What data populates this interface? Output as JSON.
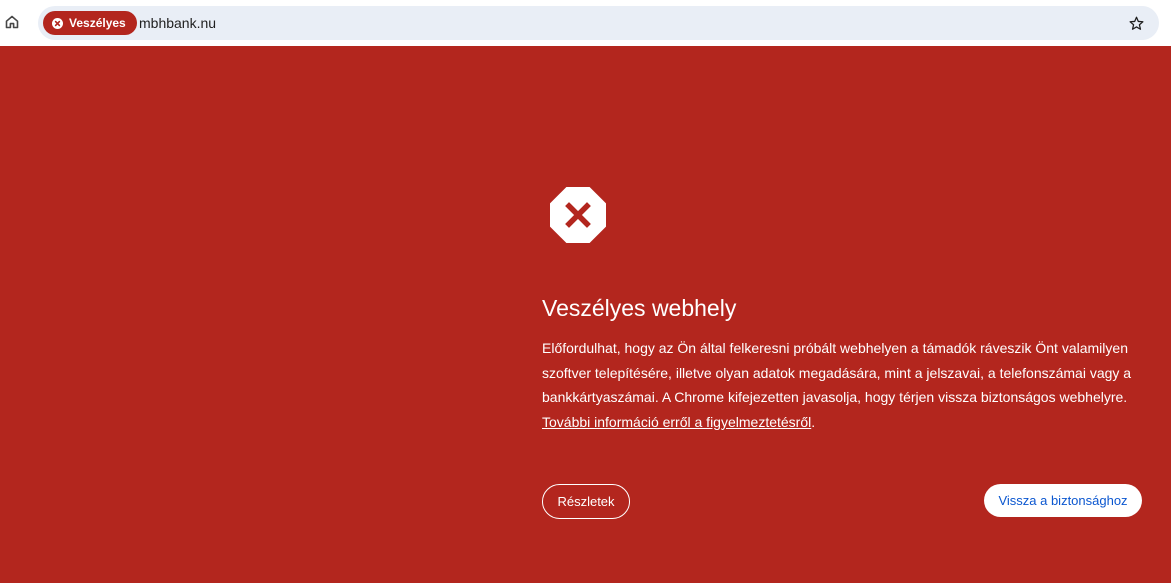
{
  "toolbar": {
    "home_icon": "home-icon",
    "bookmark_icon": "star-icon",
    "omnibox": {
      "security_chip_label": "Veszélyes",
      "security_chip_icon": "error-circle-icon",
      "url": "mbhbank.nu"
    }
  },
  "interstitial": {
    "icon": "danger-octagon-icon",
    "heading": "Veszélyes webhely",
    "body": "Előfordulhat, hogy az Ön által felkeresni próbált webhelyen a támadók ráveszik Önt valamilyen szoftver telepítésére, illetve olyan adatok megadására, mint a jelszavai, a telefonszámai vagy a bankkártyaszámai. A Chrome kifejezetten javasolja, hogy térjen vissza biztonságos webhelyre.",
    "learn_more_link": "További információ erről a figyelmeztetésről",
    "trailing_period": ".",
    "details_button": "Részletek",
    "back_to_safety_button": "Vissza a biztonsághoz"
  },
  "colors": {
    "danger_red": "#b3261e",
    "omnibox_bg": "#e9eef6",
    "link_blue": "#0b57d0",
    "white": "#ffffff"
  }
}
